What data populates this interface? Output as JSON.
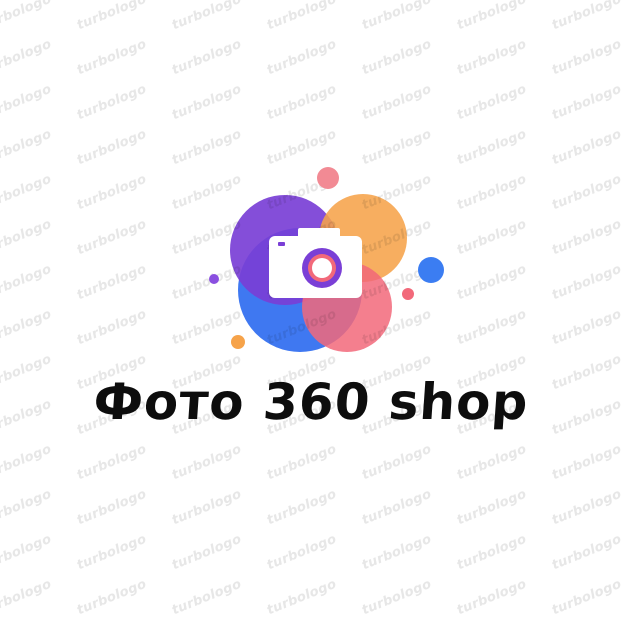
{
  "brand": {
    "name": "Фото 360 shop",
    "watermark_text": "turbologo"
  },
  "logo": {
    "icon": "camera-icon",
    "colors": {
      "purple": "#7a3fd6",
      "blue": "#2f6cf0",
      "orange": "#f6a34a",
      "pink": "#f2697a",
      "camera_body": "#ffffff",
      "lens_ring": "#7a3fd6"
    }
  }
}
